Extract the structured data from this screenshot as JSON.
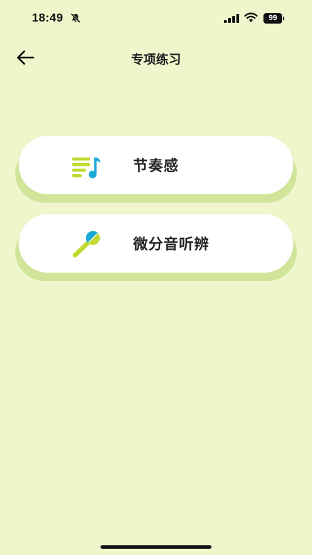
{
  "status_bar": {
    "time": "18:49",
    "battery_level": "99"
  },
  "header": {
    "title": "专项练习"
  },
  "practice_items": [
    {
      "label": "节奏感",
      "icon": "music-list-icon"
    },
    {
      "label": "微分音听辨",
      "icon": "microphone-icon"
    }
  ],
  "colors": {
    "background": "#eff6cc",
    "card_shadow": "#d1e59a",
    "card_face": "#ffffff",
    "icon_lime": "#c1d930",
    "icon_blue": "#1ba8d8"
  }
}
